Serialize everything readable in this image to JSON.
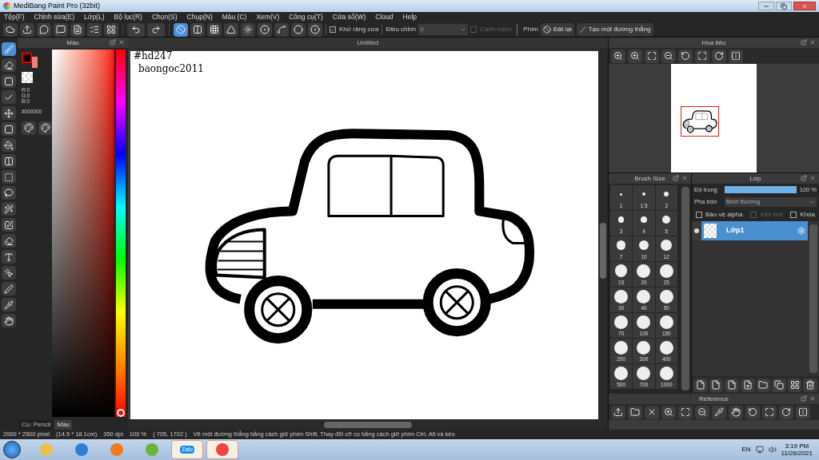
{
  "window": {
    "title": "MediBang Paint Pro (32bit)"
  },
  "menu": [
    "Tệp(F)",
    "Chỉnh sửa(E)",
    "Lớp(L)",
    "Bộ lọc(R)",
    "Chọn(S)",
    "Chụp(N)",
    "Màu (C)",
    "Xem(V)",
    "Công cụ(T)",
    "Cửa sổ(W)",
    "Cloud",
    "Help"
  ],
  "toolbar": {
    "snaps": [
      {
        "kind": "off",
        "selected": true
      },
      {
        "kind": "parallel",
        "selected": false
      },
      {
        "kind": "grid",
        "selected": false
      },
      {
        "kind": "perspective",
        "selected": false
      },
      {
        "kind": "radial",
        "selected": false
      },
      {
        "kind": "concentric",
        "selected": false
      },
      {
        "kind": "curve",
        "selected": false
      },
      {
        "kind": "circle",
        "selected": false
      },
      {
        "kind": "ring",
        "selected": false
      }
    ],
    "antialias": {
      "label": "Khử răng cưa",
      "checked": true
    },
    "adjust": {
      "label": "Điều chỉnh",
      "value": "0"
    },
    "soft_edge": {
      "label": "Cạnh mềm",
      "checked": false
    },
    "key_label": "Phím",
    "reset_button": "Đặt lại",
    "line_button": "Tạo một đường thẳng"
  },
  "tools": [
    {
      "kind": "brush",
      "selected": true
    },
    {
      "kind": "eraser",
      "selected": false
    },
    {
      "kind": "dot",
      "selected": false
    },
    {
      "kind": "check",
      "selected": false
    },
    {
      "kind": "move",
      "selected": false
    },
    {
      "kind": "fill",
      "selected": false
    },
    {
      "kind": "bucket",
      "selected": false
    },
    {
      "kind": "gradient",
      "selected": false
    },
    {
      "kind": "marquee",
      "selected": false
    },
    {
      "kind": "lasso",
      "selected": false
    },
    {
      "kind": "wand",
      "selected": false
    },
    {
      "kind": "selpen",
      "selected": false
    },
    {
      "kind": "selerase",
      "selected": false
    },
    {
      "kind": "text",
      "selected": false
    },
    {
      "kind": "operation",
      "selected": false
    },
    {
      "kind": "divide",
      "selected": false
    },
    {
      "kind": "eyedropper",
      "selected": false
    },
    {
      "kind": "hand",
      "selected": false
    }
  ],
  "color_panel": {
    "title": "Màu",
    "hue": {
      "level": 0
    },
    "rgb": [
      "R:0",
      "G:0",
      "B:0"
    ],
    "hex": "#000000",
    "tabs": [
      {
        "label": "Cọ: Pencil",
        "selected": false
      },
      {
        "label": "Màu",
        "selected": true
      }
    ]
  },
  "canvas": {
    "tab": "Untitled",
    "texts": [
      "#hd247",
      "baongoc2011"
    ]
  },
  "navigator": {
    "title": "Hoa tiêu"
  },
  "brush_size": {
    "title": "Brush Size",
    "sizes": [
      "1",
      "1.5",
      "2",
      "3",
      "4",
      "5",
      "7",
      "10",
      "12",
      "15",
      "20",
      "25",
      "30",
      "40",
      "50",
      "70",
      "100",
      "150",
      "200",
      "300",
      "400",
      "500",
      "700",
      "1000"
    ]
  },
  "layers": {
    "title": "Lớp",
    "opacity": {
      "label": "Độ trong",
      "level": 1,
      "reading": "100 %"
    },
    "blend": {
      "label": "Pha trộn",
      "value": "Bình thường"
    },
    "options": [
      {
        "label": "Bảo vệ alpha",
        "checked": false,
        "disabled": false
      },
      {
        "label": "Xén bớt",
        "checked": false,
        "disabled": true
      },
      {
        "label": "Khóa",
        "checked": false,
        "disabled": false
      }
    ],
    "items": [
      {
        "name": "Lớp1",
        "selected": true,
        "visible": true
      }
    ]
  },
  "reference": {
    "title": "Reference"
  },
  "status_bar": [
    "2000 * 2500 pixel",
    "(14.5 * 18.1cm)",
    "350 dpi",
    "100 %",
    "( 705, 1702 )",
    "Vẽ một đường thẳng bằng cách giữ phím Shift, Thay đổi cỡ cọ bằng cách giữ phím Ctrl, Alt và kéo"
  ],
  "taskbar": {
    "apps": [
      {
        "kind": "folder",
        "selected": false
      },
      {
        "kind": "browser",
        "selected": false
      },
      {
        "kind": "media",
        "selected": false
      },
      {
        "kind": "coccoc",
        "selected": false
      },
      {
        "kind": "chat",
        "label": "Zalo",
        "selected": true
      },
      {
        "kind": "paint",
        "selected": true
      }
    ],
    "language": "EN",
    "time": "3:19 PM",
    "date": "11/26/2021"
  }
}
